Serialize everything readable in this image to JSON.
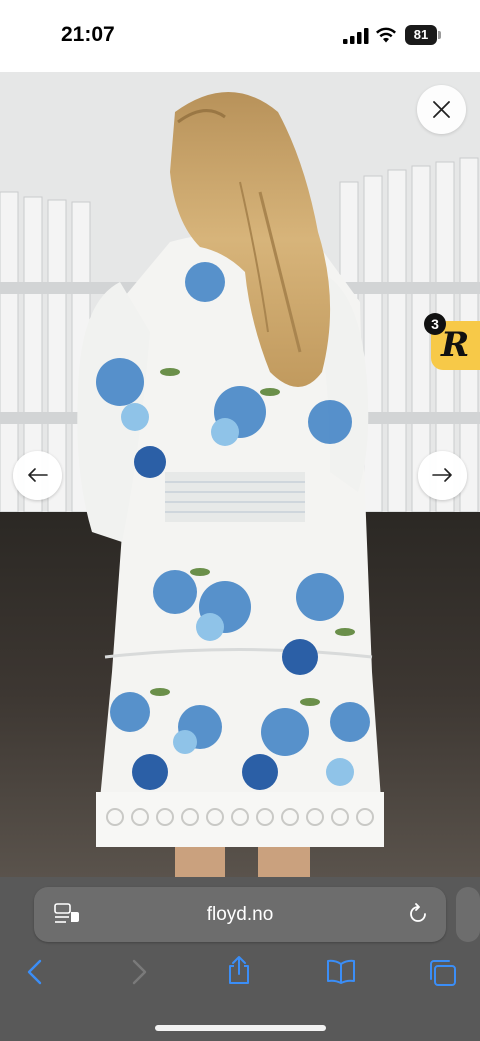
{
  "status_bar": {
    "time": "21:07",
    "battery_percent": "81",
    "icons": [
      "signal-icon",
      "wifi-icon",
      "battery-icon"
    ]
  },
  "photo": {
    "subject": "model wearing white dress with blue floral print, seen from behind",
    "colors": {
      "dress_base": "#f4f4f2",
      "flower_blue": "#3b7fc4",
      "flower_light": "#8fc3e8",
      "leaf_green": "#6a8f4a",
      "hair": "#c9a46a"
    }
  },
  "overlay": {
    "close_icon": "close-icon",
    "prev_icon": "arrow-left-icon",
    "next_icon": "arrow-right-icon",
    "badge": {
      "letter": "R",
      "count": "3",
      "color": "#f7c948"
    }
  },
  "browser": {
    "url": "floyd.no",
    "icons": [
      "page-menu-icon",
      "reload-icon",
      "back-icon",
      "forward-icon",
      "share-icon",
      "bookmarks-icon",
      "tabs-icon"
    ],
    "accent": "#3b8ef7"
  }
}
